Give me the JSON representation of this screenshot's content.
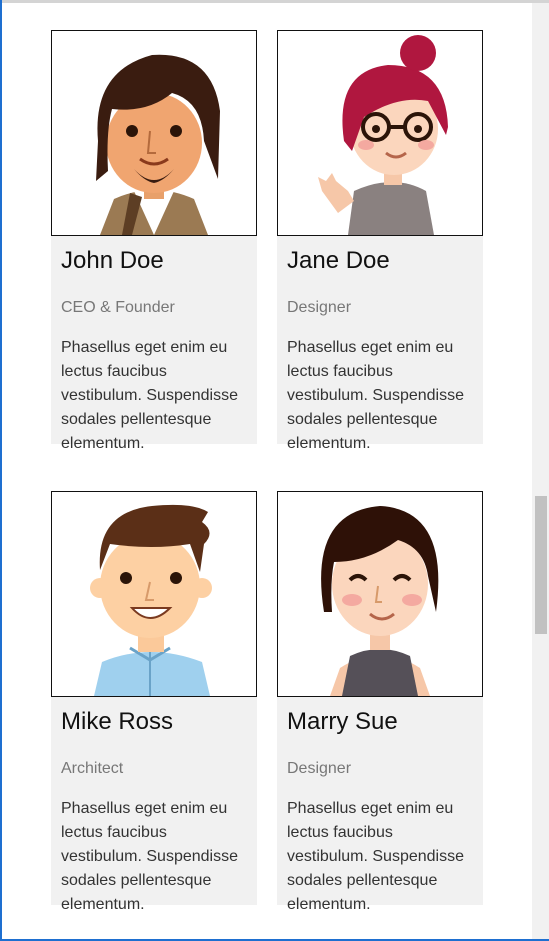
{
  "team": [
    {
      "name": "John Doe",
      "role": "CEO & Founder",
      "description": "Phasellus eget enim eu lectus faucibus vestibulum. Suspendisse sodales pellentesque elementum."
    },
    {
      "name": "Jane Doe",
      "role": "Designer",
      "description": "Phasellus eget enim eu lectus faucibus vestibulum. Suspendisse sodales pellentesque elementum."
    },
    {
      "name": "Mike Ross",
      "role": "Architect",
      "description": "Phasellus eget enim eu lectus faucibus vestibulum. Suspendisse sodales pellentesque elementum."
    },
    {
      "name": "Marry Sue",
      "role": "Designer",
      "description": "Phasellus eget enim eu lectus faucibus vestibulum. Suspendisse sodales pellentesque elementum."
    }
  ],
  "colors": {
    "card_background": "#f1f1f1",
    "name_text": "#111111",
    "role_text": "#777777",
    "description_text": "#333333"
  },
  "icons": [
    "man-with-beard-avatar",
    "woman-with-glasses-avatar",
    "man-smiling-avatar",
    "woman-winking-avatar"
  ]
}
